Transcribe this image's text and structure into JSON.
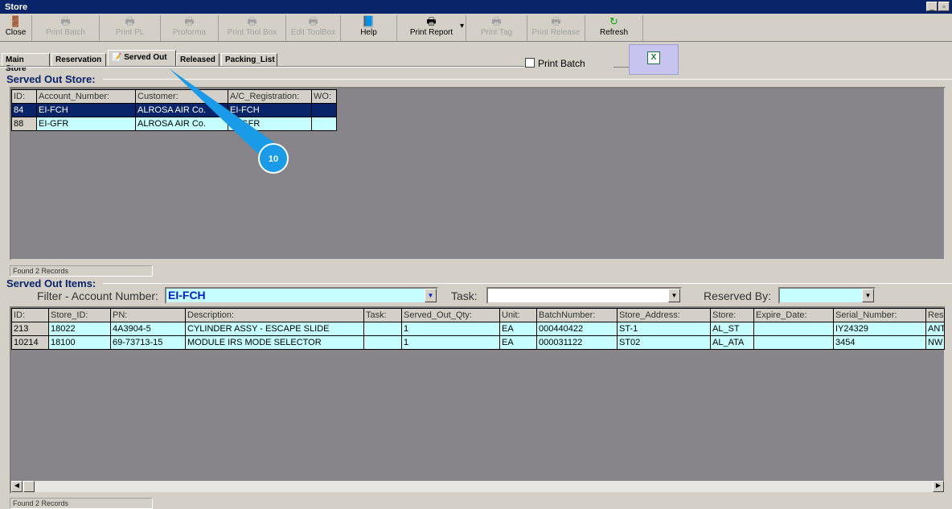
{
  "window": {
    "title": "Store"
  },
  "toolbar": [
    {
      "label": "Close",
      "icon": "door-exit-icon",
      "enabled": true
    },
    {
      "label": "Print Batch",
      "icon": "printer-icon",
      "enabled": false
    },
    {
      "label": "Print PL",
      "icon": "printer-icon",
      "enabled": false
    },
    {
      "label": "Proforma",
      "icon": "printer-icon",
      "enabled": false
    },
    {
      "label": "Print Tool Box",
      "icon": "printer-icon",
      "enabled": false
    },
    {
      "label": "Edit ToolBox",
      "icon": "printer-icon",
      "enabled": false
    },
    {
      "label": "Help",
      "icon": "help-book-icon",
      "enabled": true
    },
    {
      "label": "Print Report",
      "icon": "printer-icon",
      "enabled": true
    },
    {
      "label": "Print Tag",
      "icon": "printer-icon",
      "enabled": false
    },
    {
      "label": "Print Release",
      "icon": "printer-icon",
      "enabled": false
    },
    {
      "label": "Refresh",
      "icon": "refresh-icon",
      "enabled": true
    }
  ],
  "tabs": [
    "Main Store",
    "Reservation",
    "Served Out",
    "Released",
    "Packing_List"
  ],
  "print_batch_label": "Print Batch",
  "store": {
    "title": "Served Out Store:",
    "columns": [
      "ID:",
      "Account_Number:",
      "Customer:",
      "A/C_Registration:",
      "WO:"
    ],
    "rows": [
      [
        "84",
        "EI-FCH",
        "ALROSA AIR Co.",
        "EI-FCH",
        ""
      ],
      [
        "88",
        "EI-GFR",
        "ALROSA AIR Co.",
        "EI-GFR",
        ""
      ]
    ],
    "status": "Found 2 Records"
  },
  "items": {
    "title": "Served Out Items:",
    "filter_label": "Filter - Account Number:",
    "filter_value": "EI-FCH",
    "task_label": "Task:",
    "task_value": "",
    "reserved_label": "Reserved By:",
    "reserved_value": "",
    "columns": [
      "ID:",
      "Store_ID:",
      "PN:",
      "Description:",
      "Task:",
      "Served_Out_Qty:",
      "Unit:",
      "BatchNumber:",
      "Store_Address:",
      "Store:",
      "Expire_Date:",
      "Serial_Number:",
      "Res"
    ],
    "rows": [
      [
        "213",
        "18022",
        "4A3904-5",
        "CYLINDER ASSY - ESCAPE SLIDE",
        "",
        "1",
        "EA",
        "000440422",
        "ST-1",
        "AL_ST",
        "",
        "IY24329",
        "ANT"
      ],
      [
        "10214",
        "18100",
        "69-73713-15",
        "MODULE IRS MODE SELECTOR",
        "",
        "1",
        "EA",
        "000031122",
        "ST02",
        "AL_ATA",
        "",
        "3454",
        "NW"
      ]
    ],
    "status": "Found 2 Records"
  },
  "callout": {
    "number": "10",
    "color": "#1a9be8"
  }
}
